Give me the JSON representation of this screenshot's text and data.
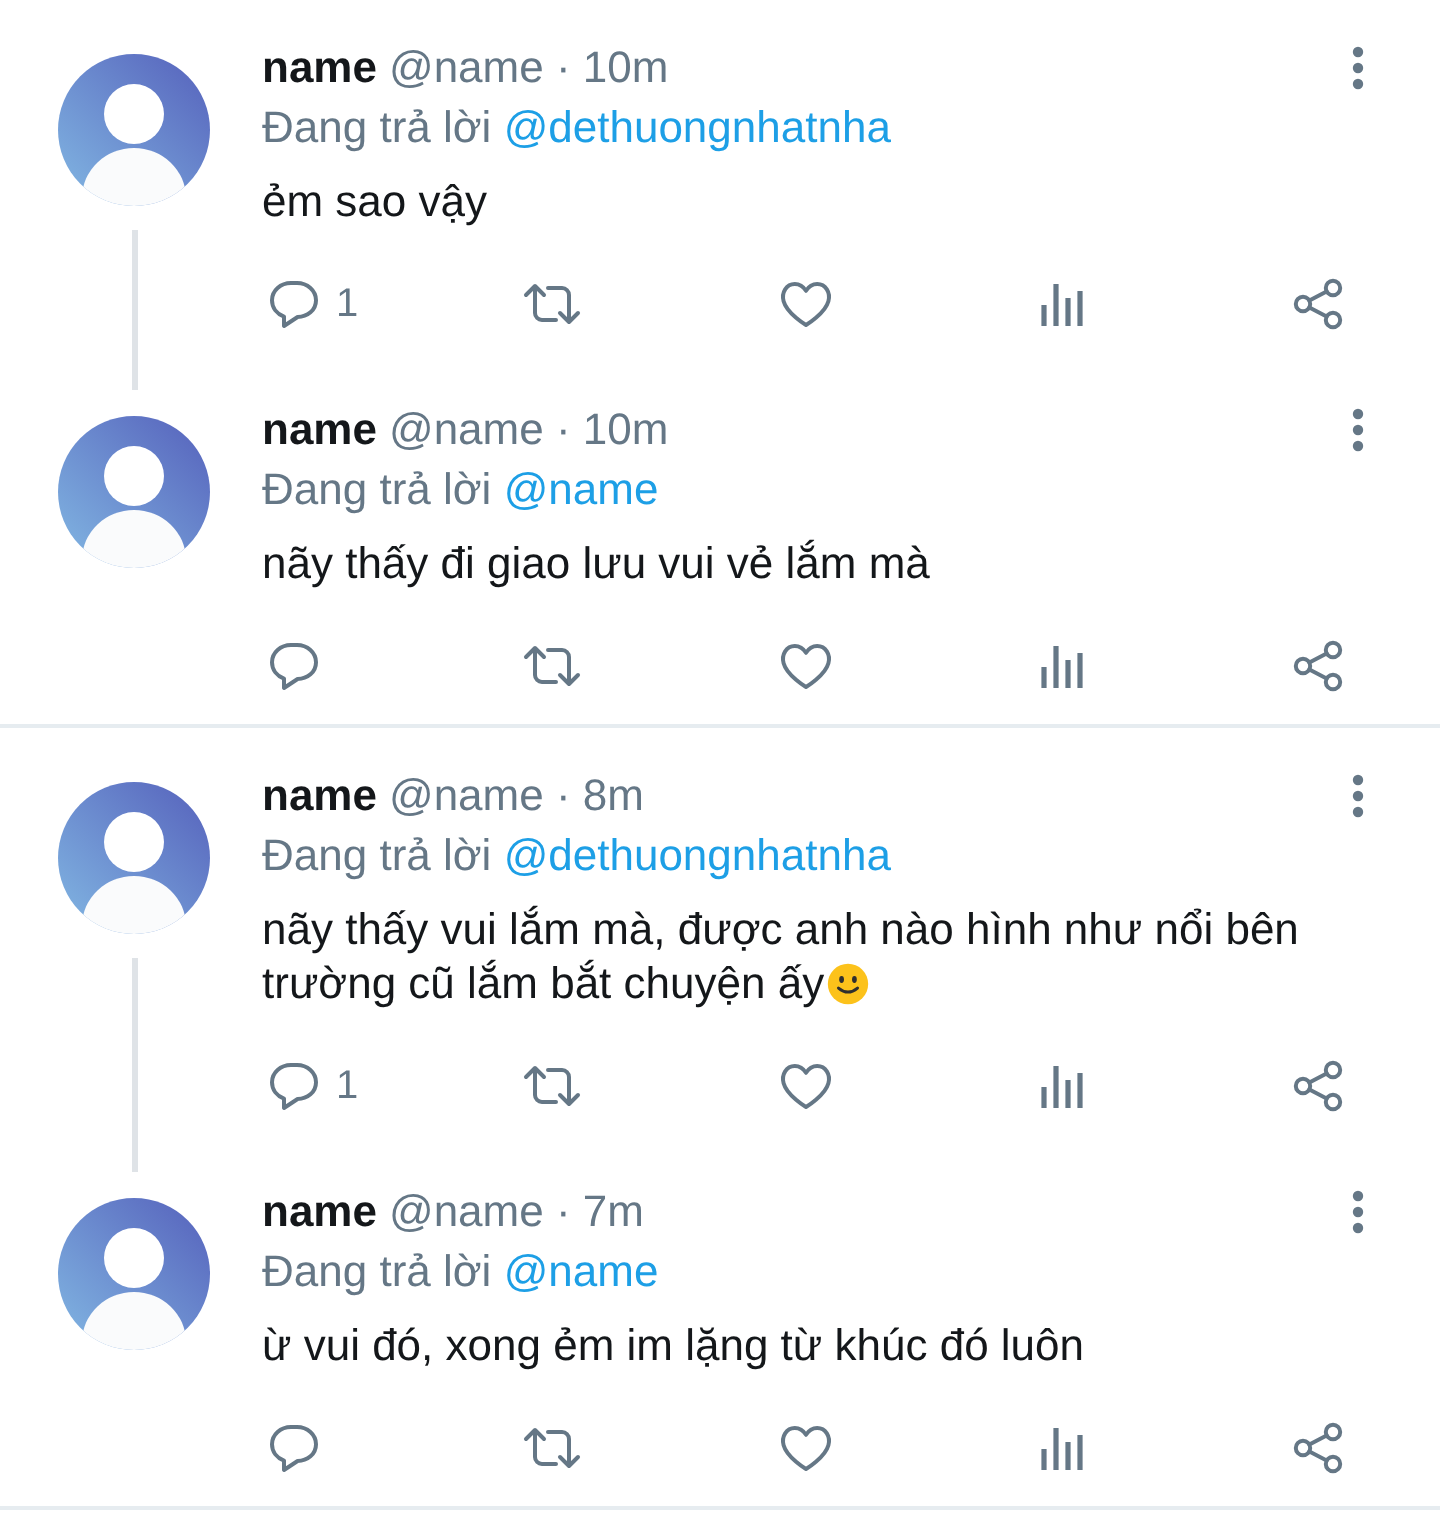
{
  "threads": [
    {
      "tweets": [
        {
          "name": "name",
          "meta": "@name · 10m",
          "replying": {
            "label": "Đang trả lời",
            "handle": "@dethuongnhatnha"
          },
          "text": "ẻm sao vậy",
          "reply_count": "1",
          "thread_line": true
        },
        {
          "name": "name",
          "meta": "@name · 10m",
          "replying": {
            "label": "Đang trả lời",
            "handle": "@name"
          },
          "text": "nãy thấy đi giao lưu vui vẻ lắm mà",
          "thread_line": false
        }
      ]
    },
    {
      "tweets": [
        {
          "name": "name",
          "meta": "@name · 8m",
          "replying": {
            "label": "Đang trả lời",
            "handle": "@dethuongnhatnha"
          },
          "text": "nãy thấy vui lắm mà, được anh nào hình như nổi bên trường cũ lắm bắt chuyện ấy",
          "emoji": {
            "kind": "smile"
          },
          "reply_count": "1",
          "thread_line": true
        },
        {
          "name": "name",
          "meta": "@name · 7m",
          "replying": {
            "label": "Đang trả lời",
            "handle": "@name"
          },
          "text": "ừ vui đó, xong ẻm im lặng từ khúc đó luôn",
          "thread_line": false
        }
      ]
    }
  ]
}
